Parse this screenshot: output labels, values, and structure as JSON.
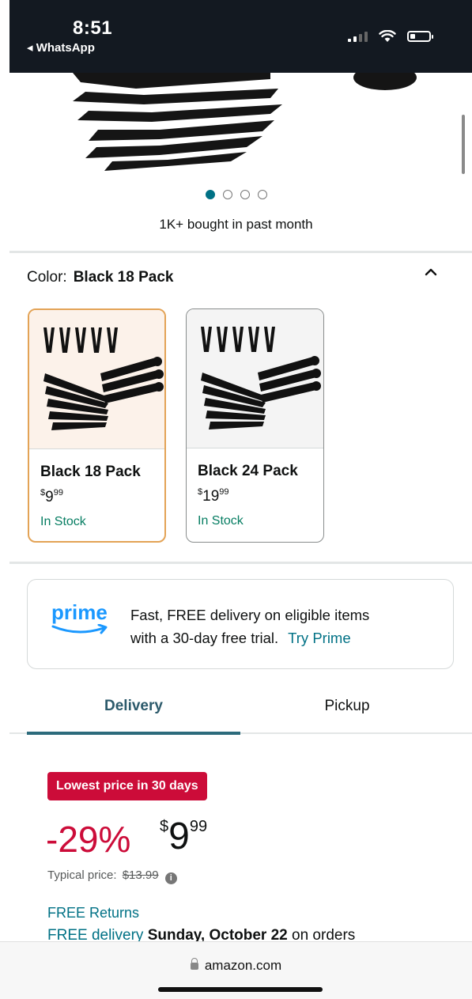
{
  "status_bar": {
    "time": "8:51",
    "back_app": "◂ WhatsApp"
  },
  "gallery": {
    "dot_count": 4,
    "active_index": 0,
    "bought_text": "1K+ bought in past month"
  },
  "color": {
    "label": "Color:",
    "selected": "Black 18 Pack",
    "options": [
      {
        "name": "Black 18 Pack",
        "price_symbol": "$",
        "price_whole": "9",
        "price_cents": "99",
        "stock": "In Stock"
      },
      {
        "name": "Black 24 Pack",
        "price_symbol": "$",
        "price_whole": "19",
        "price_cents": "99",
        "stock": "In Stock"
      }
    ]
  },
  "prime": {
    "logo_text": "prime",
    "line1": "Fast, FREE delivery on eligible items",
    "line2": "with a 30-day free trial.",
    "link": "Try Prime"
  },
  "tabs": {
    "delivery": "Delivery",
    "pickup": "Pickup"
  },
  "deal": {
    "badge": "Lowest price in 30 days",
    "discount": "-29%",
    "currency": "$",
    "price_whole": "9",
    "price_cents": "99",
    "typical_label": "Typical price:",
    "typical_price": "$13.99"
  },
  "delivery": {
    "free_returns": "FREE Returns",
    "free_delivery": "FREE delivery",
    "date": "Sunday, October 22",
    "suffix": "on orders"
  },
  "browser": {
    "url": "amazon.com"
  },
  "colors": {
    "accent_teal": "#007185",
    "deal_red": "#cc0c39",
    "prime_blue": "#1a98ff",
    "selected_border": "#e3a356"
  }
}
